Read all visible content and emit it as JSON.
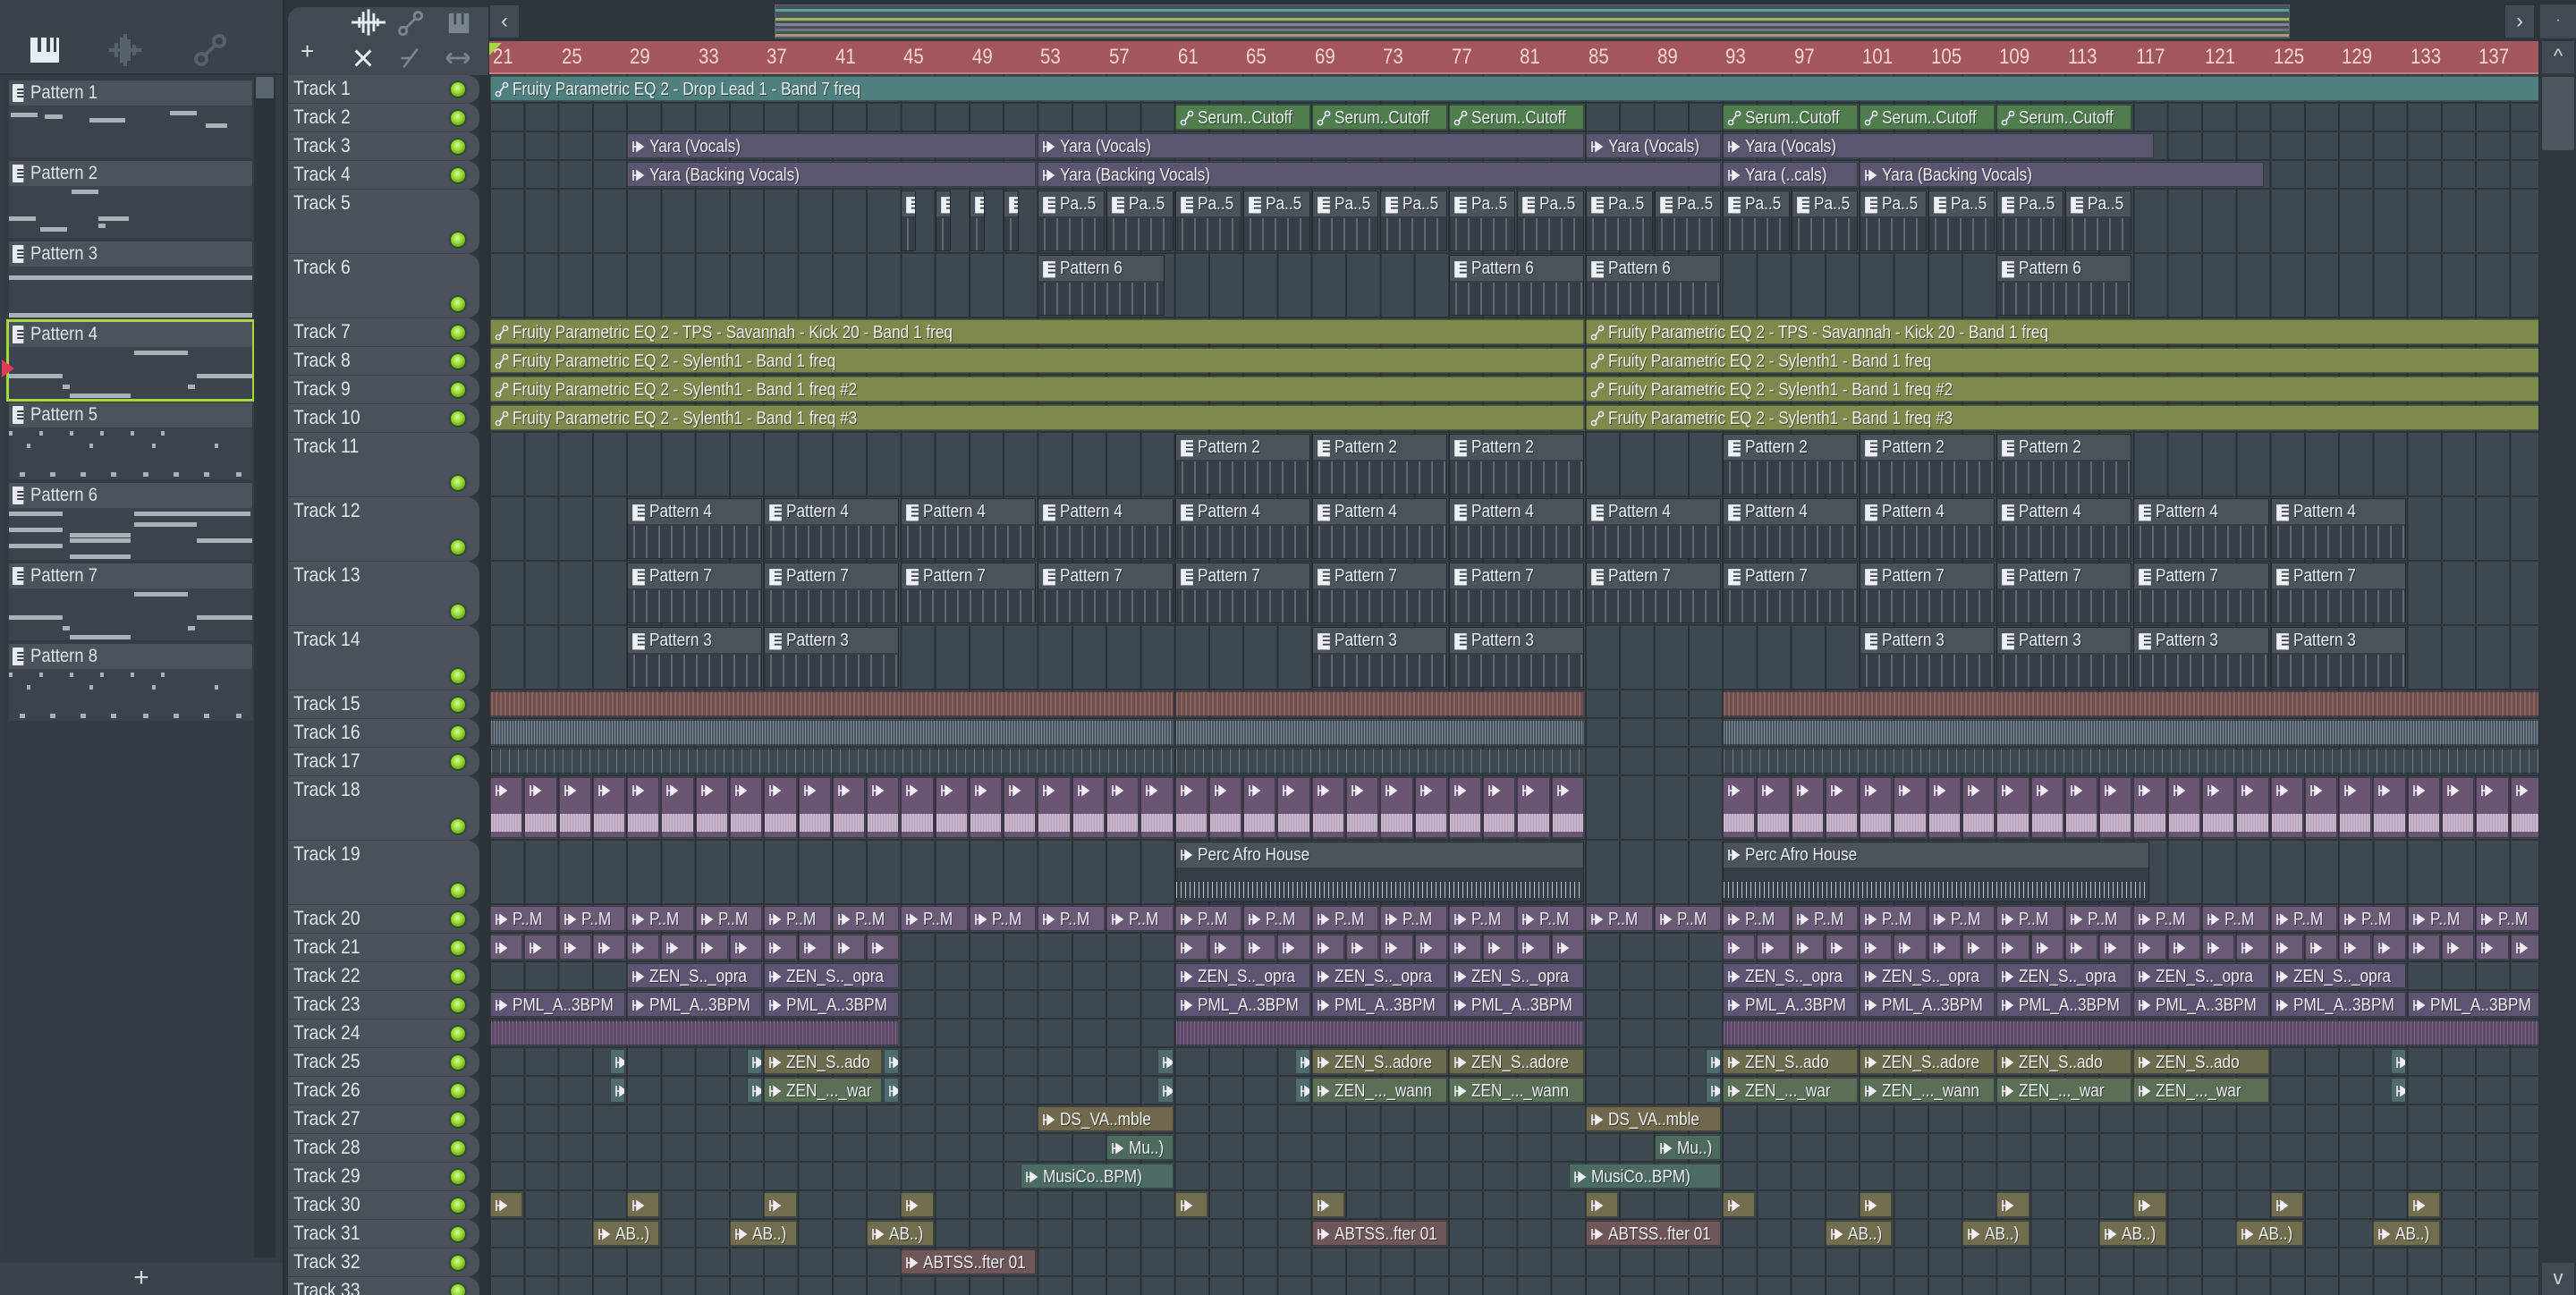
{
  "browser": {
    "patterns": [
      "Pattern 1",
      "Pattern 2",
      "Pattern 3",
      "Pattern 4",
      "Pattern 5",
      "Pattern 6",
      "Pattern 7",
      "Pattern 8"
    ],
    "selected_pattern": "Pattern 4",
    "add_label": "+"
  },
  "toolbar": {
    "add_track": "+"
  },
  "ruler": {
    "bars": [
      21,
      25,
      29,
      33,
      37,
      41,
      45,
      49,
      53,
      57,
      61,
      65,
      69,
      73,
      77,
      81,
      85,
      89,
      93,
      97,
      101,
      105,
      109,
      113,
      117,
      121,
      125,
      129,
      133,
      137
    ]
  },
  "nav": {
    "left": "‹",
    "right": "›",
    "up": "^",
    "down": "v",
    "corner": "·"
  },
  "colors": {
    "ruler": "#a3575c",
    "selection": "#a6d83c",
    "led": "#8fd629"
  },
  "tracks": [
    {
      "name": "Track 1",
      "clips": [
        {
          "start": 21,
          "len": 120,
          "kind": "auto-teal",
          "label": "Fruity Parametric EQ 2 - Drop Lead 1 - Band 7 freq"
        }
      ]
    },
    {
      "name": "Track 2",
      "clips": [
        {
          "start": 61,
          "len": 8,
          "count": 3,
          "kind": "auto-green",
          "label": "Serum..Cutoff"
        },
        {
          "start": 93,
          "len": 8,
          "count": 3,
          "kind": "auto-green",
          "label": "Serum..Cutoff"
        }
      ]
    },
    {
      "name": "Track 3",
      "clips": [
        {
          "start": 29,
          "len": 24,
          "kind": "vocal",
          "label": "Yara  (Vocals)"
        },
        {
          "start": 53,
          "len": 32,
          "kind": "vocal",
          "label": "Yara  (Vocals)"
        },
        {
          "start": 85,
          "len": 8,
          "kind": "vocal",
          "label": "Yara  (Vocals)"
        },
        {
          "start": 93,
          "len": 25.3,
          "kind": "vocal",
          "label": "Yara  (Vocals)"
        }
      ]
    },
    {
      "name": "Track 4",
      "clips": [
        {
          "start": 29,
          "len": 24,
          "kind": "vocal",
          "label": "Yara  (Backing Vocals)"
        },
        {
          "start": 53,
          "len": 40,
          "kind": "vocal",
          "label": "Yara  (Backing Vocals)"
        },
        {
          "start": 93,
          "len": 8,
          "kind": "vocal",
          "label": "Yara  (..cals)"
        },
        {
          "start": 101,
          "len": 23.7,
          "kind": "vocal",
          "label": "Yara  (Backing Vocals)"
        }
      ]
    },
    {
      "name": "Track 5",
      "clips": [
        {
          "start": 45,
          "len": 1,
          "every": 2,
          "count": 4,
          "kind": "pattern"
        },
        {
          "start": 53,
          "len": 4,
          "count": 16,
          "kind": "pattern",
          "label": "Pa..5"
        }
      ]
    },
    {
      "name": "Track 6",
      "clips": [
        {
          "start": 53,
          "len": 7.5,
          "kind": "pattern",
          "label": "Pattern 6"
        },
        {
          "start": 77,
          "len": 8,
          "count": 2,
          "kind": "pattern",
          "label": "Pattern 6"
        },
        {
          "start": 109,
          "len": 8,
          "kind": "pattern",
          "label": "Pattern 6"
        }
      ]
    },
    {
      "name": "Track 7",
      "clips": [
        {
          "start": 21,
          "len": 64,
          "kind": "auto-olive",
          "label": "Fruity Parametric EQ 2 - TPS - Savannah - Kick 20 - Band 1 freq"
        },
        {
          "start": 85,
          "len": 56,
          "kind": "auto-olive",
          "label": "Fruity Parametric EQ 2 - TPS - Savannah - Kick 20 - Band 1 freq"
        }
      ]
    },
    {
      "name": "Track 8",
      "clips": [
        {
          "start": 21,
          "len": 64,
          "kind": "auto-olive",
          "label": "Fruity Parametric EQ 2 - Sylenth1 - Band 1 freq"
        },
        {
          "start": 85,
          "len": 56,
          "kind": "auto-olive",
          "label": "Fruity Parametric EQ 2 - Sylenth1 - Band 1 freq"
        }
      ]
    },
    {
      "name": "Track 9",
      "clips": [
        {
          "start": 21,
          "len": 64,
          "kind": "auto-olive",
          "label": "Fruity Parametric EQ 2 - Sylenth1 - Band 1 freq #2"
        },
        {
          "start": 85,
          "len": 56,
          "kind": "auto-olive",
          "label": "Fruity Parametric EQ 2 - Sylenth1 - Band 1 freq #2"
        }
      ]
    },
    {
      "name": "Track 10",
      "clips": [
        {
          "start": 21,
          "len": 64,
          "kind": "auto-olive",
          "label": "Fruity Parametric EQ 2 - Sylenth1 - Band 1 freq #3"
        },
        {
          "start": 85,
          "len": 56,
          "kind": "auto-olive",
          "label": "Fruity Parametric EQ 2 - Sylenth1 - Band 1 freq #3"
        }
      ]
    },
    {
      "name": "Track 11",
      "clips": [
        {
          "start": 61,
          "len": 8,
          "count": 3,
          "kind": "pattern",
          "label": "Pattern 2"
        },
        {
          "start": 93,
          "len": 8,
          "count": 3,
          "kind": "pattern",
          "label": "Pattern 2"
        }
      ]
    },
    {
      "name": "Track 12",
      "clips": [
        {
          "start": 29,
          "len": 8,
          "count": 13,
          "kind": "pattern",
          "label": "Pattern 4"
        }
      ]
    },
    {
      "name": "Track 13",
      "clips": [
        {
          "start": 29,
          "len": 8,
          "count": 13,
          "kind": "pattern",
          "label": "Pattern 7"
        }
      ]
    },
    {
      "name": "Track 14",
      "clips": [
        {
          "start": 29,
          "len": 8,
          "count": 2,
          "kind": "pattern",
          "label": "Pattern 3"
        },
        {
          "start": 69,
          "len": 8,
          "count": 2,
          "kind": "pattern",
          "label": "Pattern 3"
        },
        {
          "start": 101,
          "len": 8,
          "count": 4,
          "kind": "pattern",
          "label": "Pattern 3"
        }
      ]
    },
    {
      "name": "Track 15",
      "clips": [
        {
          "start": 21,
          "len": 40,
          "kind": "stripes-red"
        },
        {
          "start": 61,
          "len": 24,
          "kind": "stripes-red"
        },
        {
          "start": 93,
          "len": 48,
          "kind": "stripes-red"
        }
      ]
    },
    {
      "name": "Track 16",
      "clips": [
        {
          "start": 21,
          "len": 40,
          "kind": "stripes-gray"
        },
        {
          "start": 61,
          "len": 24,
          "kind": "stripes-gray"
        },
        {
          "start": 93,
          "len": 48,
          "kind": "stripes-gray"
        }
      ]
    },
    {
      "name": "Track 17",
      "clips": [
        {
          "start": 21,
          "len": 40,
          "kind": "stripes-dark"
        },
        {
          "start": 61,
          "len": 24,
          "kind": "stripes-dark"
        },
        {
          "start": 93,
          "len": 48,
          "kind": "stripes-dark"
        }
      ]
    },
    {
      "name": "Track 18",
      "clips": [
        {
          "start": 21,
          "len": 2,
          "count": 20,
          "kind": "pink"
        },
        {
          "start": 61,
          "len": 2,
          "count": 12,
          "kind": "pink"
        },
        {
          "start": 93,
          "len": 2,
          "count": 24,
          "kind": "pink"
        }
      ]
    },
    {
      "name": "Track 19",
      "clips": [
        {
          "start": 61,
          "len": 24,
          "kind": "perc",
          "label": "Perc Afro House"
        },
        {
          "start": 93,
          "len": 25,
          "kind": "perc",
          "label": "Perc Afro House"
        }
      ]
    },
    {
      "name": "Track 20",
      "clips": [
        {
          "start": 21,
          "len": 4,
          "count": 30,
          "kind": "pm",
          "label": "P..M"
        }
      ]
    },
    {
      "name": "Track 21",
      "clips": [
        {
          "start": 21,
          "len": 2,
          "count": 12,
          "kind": "pm"
        },
        {
          "start": 61,
          "len": 2,
          "count": 12,
          "kind": "pm"
        },
        {
          "start": 93,
          "len": 2,
          "count": 24,
          "kind": "pm"
        }
      ]
    },
    {
      "name": "Track 22",
      "clips": [
        {
          "start": 29,
          "len": 8,
          "count": 2,
          "kind": "purple",
          "label": "ZEN_S.._opra"
        },
        {
          "start": 61,
          "len": 8,
          "count": 3,
          "kind": "purple",
          "label": "ZEN_S.._opra"
        },
        {
          "start": 93,
          "len": 8,
          "count": 5,
          "kind": "purple",
          "label": "ZEN_S.._opra"
        }
      ]
    },
    {
      "name": "Track 23",
      "clips": [
        {
          "start": 21,
          "len": 8,
          "count": 3,
          "kind": "purple",
          "label": "PML_A..3BPM"
        },
        {
          "start": 61,
          "len": 8,
          "count": 3,
          "kind": "purple",
          "label": "PML_A..3BPM"
        },
        {
          "start": 93,
          "len": 8,
          "count": 6,
          "kind": "purple",
          "label": "PML_A..3BPM"
        }
      ]
    },
    {
      "name": "Track 24",
      "clips": [
        {
          "start": 21,
          "len": 24,
          "kind": "stripes-purple"
        },
        {
          "start": 61,
          "len": 24,
          "kind": "stripes-purple"
        },
        {
          "start": 93,
          "len": 48,
          "kind": "stripes-purple"
        }
      ]
    },
    {
      "name": "Track 25",
      "clips": [
        {
          "start": 28,
          "len": 1,
          "kind": "zen-tiny"
        },
        {
          "start": 36,
          "len": 1,
          "kind": "zen-tiny"
        },
        {
          "start": 37,
          "len": 7,
          "kind": "zen-olive",
          "label": "ZEN_S..ado"
        },
        {
          "start": 44,
          "len": 1,
          "kind": "zen-tiny"
        },
        {
          "start": 60,
          "len": 1,
          "kind": "zen-tiny"
        },
        {
          "start": 68,
          "len": 1,
          "kind": "zen-tiny"
        },
        {
          "start": 69,
          "len": 8,
          "count": 2,
          "kind": "zen-olive",
          "label": "ZEN_S..adore"
        },
        {
          "start": 92,
          "len": 1,
          "kind": "zen-tiny"
        },
        {
          "start": 93,
          "len": 8,
          "kind": "zen-olive",
          "label": "ZEN_S..ado"
        },
        {
          "start": 101,
          "len": 8,
          "kind": "zen-olive",
          "label": "ZEN_S..adore"
        },
        {
          "start": 109,
          "len": 8,
          "count": 2,
          "kind": "zen-olive",
          "label": "ZEN_S..ado"
        },
        {
          "start": 132,
          "len": 1,
          "kind": "zen-tiny"
        }
      ]
    },
    {
      "name": "Track 26",
      "clips": [
        {
          "start": 28,
          "len": 1,
          "kind": "zen-tiny"
        },
        {
          "start": 36,
          "len": 1,
          "kind": "zen-tiny"
        },
        {
          "start": 37,
          "len": 7,
          "kind": "zen-green",
          "label": "ZEN_..._war"
        },
        {
          "start": 44,
          "len": 1,
          "kind": "zen-tiny"
        },
        {
          "start": 60,
          "len": 1,
          "kind": "zen-tiny"
        },
        {
          "start": 68,
          "len": 1,
          "kind": "zen-tiny"
        },
        {
          "start": 69,
          "len": 8,
          "count": 2,
          "kind": "zen-green",
          "label": "ZEN_..._wann"
        },
        {
          "start": 92,
          "len": 1,
          "kind": "zen-tiny"
        },
        {
          "start": 93,
          "len": 8,
          "kind": "zen-green",
          "label": "ZEN_..._war"
        },
        {
          "start": 101,
          "len": 8,
          "kind": "zen-green",
          "label": "ZEN_..._wann"
        },
        {
          "start": 109,
          "len": 8,
          "count": 2,
          "kind": "zen-green",
          "label": "ZEN_..._war"
        },
        {
          "start": 132,
          "len": 1,
          "kind": "zen-tiny"
        }
      ]
    },
    {
      "name": "Track 27",
      "clips": [
        {
          "start": 53,
          "len": 8,
          "kind": "brown",
          "label": "DS_VA..mble"
        },
        {
          "start": 85,
          "len": 8,
          "kind": "brown",
          "label": "DS_VA..mble"
        }
      ]
    },
    {
      "name": "Track 28",
      "clips": [
        {
          "start": 57,
          "len": 4,
          "kind": "teal-green",
          "label": "Mu..)"
        },
        {
          "start": 89,
          "len": 4,
          "kind": "teal-green",
          "label": "Mu..)"
        }
      ]
    },
    {
      "name": "Track 29",
      "clips": [
        {
          "start": 52,
          "len": 9,
          "kind": "teal",
          "label": "MusiCo..BPM)"
        },
        {
          "start": 84,
          "len": 9,
          "kind": "teal",
          "label": "MusiCo..BPM)"
        }
      ]
    },
    {
      "name": "Track 30",
      "clips": [
        {
          "start": 21,
          "len": 2,
          "every": 8,
          "count": 4,
          "kind": "olive"
        },
        {
          "start": 61,
          "len": 2,
          "every": 8,
          "count": 2,
          "kind": "olive"
        },
        {
          "start": 85,
          "len": 2,
          "every": 8,
          "count": 7,
          "kind": "olive"
        }
      ]
    },
    {
      "name": "Track 31",
      "clips": [
        {
          "start": 27,
          "len": 4,
          "every": 8,
          "count": 3,
          "kind": "olive",
          "label": "AB..)"
        },
        {
          "start": 69,
          "len": 8,
          "kind": "abtss",
          "label": "ABTSS..fter 01"
        },
        {
          "start": 85,
          "len": 8,
          "kind": "abtss",
          "label": "ABTSS..fter 01"
        },
        {
          "start": 99,
          "len": 4,
          "every": 8,
          "count": 5,
          "kind": "olive",
          "label": "AB..)"
        }
      ]
    },
    {
      "name": "Track 32",
      "clips": [
        {
          "start": 45,
          "len": 8,
          "kind": "abtss",
          "label": "ABTSS..fter 01"
        }
      ]
    },
    {
      "name": "Track 33",
      "clips": []
    }
  ]
}
